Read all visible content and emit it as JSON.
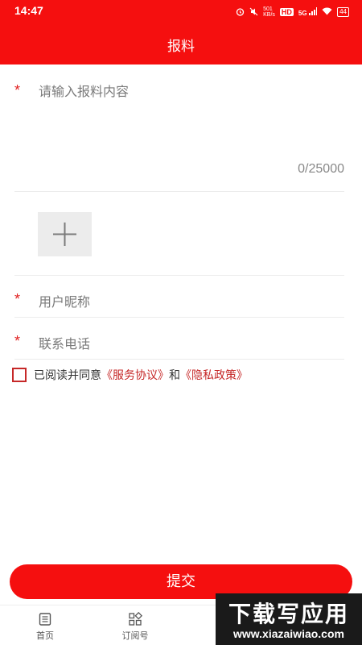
{
  "status_bar": {
    "time": "14:47",
    "network_speed": "501\nKB/s",
    "network_badge": "HD",
    "signal": "5G",
    "battery": "44"
  },
  "header": {
    "title": "报料"
  },
  "form": {
    "content": {
      "required_mark": "*",
      "placeholder": "请输入报料内容",
      "counter": "0/25000"
    },
    "nickname": {
      "required_mark": "*",
      "placeholder": "用户昵称"
    },
    "phone": {
      "required_mark": "*",
      "placeholder": "联系电话"
    },
    "agreement": {
      "prefix": "已阅读并同意",
      "service_link": "《服务协议》",
      "connector": "和",
      "privacy_link": "《隐私政策》"
    },
    "submit_label": "提交"
  },
  "bottom_nav": {
    "items": [
      {
        "label": "首页",
        "icon": "newspaper-icon"
      },
      {
        "label": "订阅号",
        "icon": "grid-icon"
      }
    ]
  },
  "watermark": {
    "title": "下载写应用",
    "url": "www.xiazaiwiao.com"
  },
  "colors": {
    "brand_red": "#f50f0f",
    "link_red": "#c62828",
    "placeholder_gray": "#7a7a7a"
  }
}
